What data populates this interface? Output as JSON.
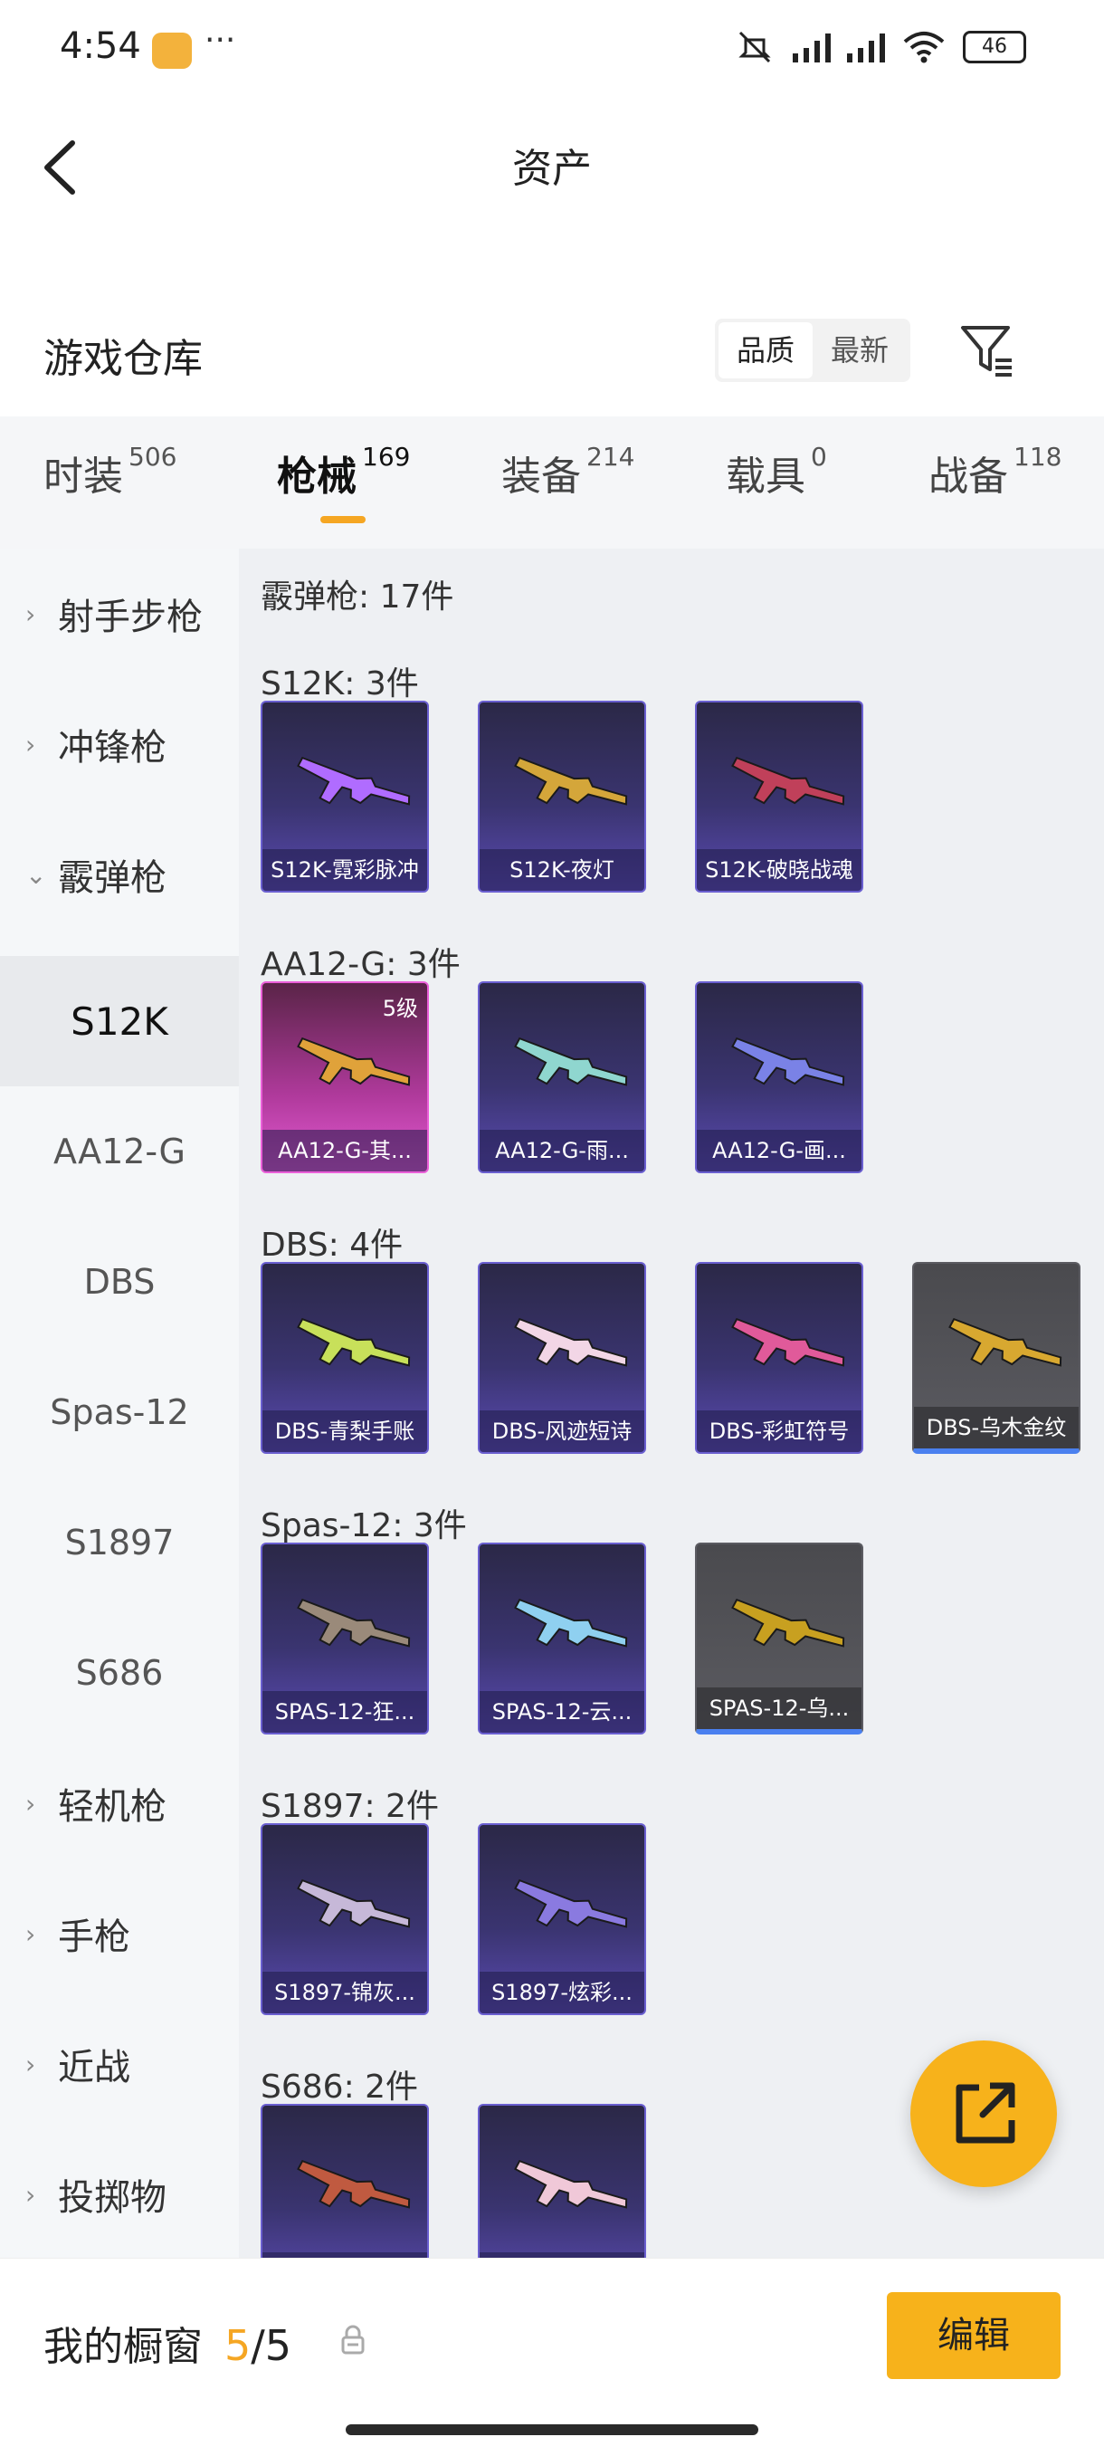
{
  "status_bar": {
    "time": "4:54",
    "dots": "···",
    "battery": "46"
  },
  "header": {
    "title": "资产"
  },
  "warehouse": {
    "title": "游戏仓库",
    "sort_quality": "品质",
    "sort_newest": "最新"
  },
  "tabs": [
    {
      "label": "时装",
      "count": "506"
    },
    {
      "label": "枪械",
      "count": "169"
    },
    {
      "label": "装备",
      "count": "214"
    },
    {
      "label": "载具",
      "count": "0"
    },
    {
      "label": "战备",
      "count": "118"
    }
  ],
  "sidebar": [
    {
      "label": "射手步枪",
      "chevron": "›"
    },
    {
      "label": "冲锋枪",
      "chevron": "›"
    },
    {
      "label": "霰弹枪",
      "chevron": "⌄"
    },
    {
      "label": "S12K"
    },
    {
      "label": "AA12-G"
    },
    {
      "label": "DBS"
    },
    {
      "label": "Spas-12"
    },
    {
      "label": "S1897"
    },
    {
      "label": "S686"
    },
    {
      "label": "轻机枪",
      "chevron": "›"
    },
    {
      "label": "手枪",
      "chevron": "›"
    },
    {
      "label": "近战",
      "chevron": "›"
    },
    {
      "label": "投掷物",
      "chevron": "›"
    }
  ],
  "content": {
    "category_header": "霰弹枪: 17件",
    "groups": [
      {
        "header": "S12K: 3件",
        "items": [
          {
            "name": "S12K-霓彩脉冲",
            "style": "purple",
            "gun_color": "#b06cff"
          },
          {
            "name": "S12K-夜灯",
            "style": "purple",
            "gun_color": "#d4a63a"
          },
          {
            "name": "S12K-破晓战魂",
            "style": "purple",
            "gun_color": "#c0405a"
          }
        ]
      },
      {
        "header": "AA12-G: 3件",
        "items": [
          {
            "name": "AA12-G-其...",
            "style": "gold",
            "level": "5级",
            "gun_color": "#e0a23a"
          },
          {
            "name": "AA12-G-雨...",
            "style": "purple",
            "gun_color": "#8fd6cf"
          },
          {
            "name": "AA12-G-画...",
            "style": "purple",
            "gun_color": "#7a82e6"
          }
        ]
      },
      {
        "header": "DBS: 4件",
        "items": [
          {
            "name": "DBS-青梨手账",
            "style": "purple",
            "gun_color": "#c8e05a"
          },
          {
            "name": "DBS-风迹短诗",
            "style": "purple",
            "gun_color": "#f2d6e6"
          },
          {
            "name": "DBS-彩虹符号",
            "style": "purple",
            "gun_color": "#e05a9a"
          },
          {
            "name": "DBS-乌木金纹",
            "style": "grey",
            "gun_color": "#d8a830"
          }
        ]
      },
      {
        "header": "Spas-12: 3件",
        "items": [
          {
            "name": "SPAS-12-狂...",
            "style": "purple",
            "gun_color": "#9a8a7a"
          },
          {
            "name": "SPAS-12-云...",
            "style": "purple",
            "gun_color": "#8fd0f0"
          },
          {
            "name": "SPAS-12-乌...",
            "style": "grey",
            "gun_color": "#c8a020"
          }
        ]
      },
      {
        "header": "S1897: 2件",
        "items": [
          {
            "name": "S1897-锦灰...",
            "style": "purple",
            "gun_color": "#c6b8d8"
          },
          {
            "name": "S1897-炫彩...",
            "style": "purple",
            "gun_color": "#8a7ae0"
          }
        ]
      },
      {
        "header": "S686: 2件",
        "items": [
          {
            "name": "",
            "style": "purple",
            "gun_color": "#c05a40"
          },
          {
            "name": "",
            "style": "purple",
            "gun_color": "#f0c8d8"
          }
        ]
      }
    ]
  },
  "bottom_bar": {
    "label": "我的橱窗",
    "count_current": "5",
    "count_sep": "/",
    "count_total": "5",
    "edit_label": "编辑"
  },
  "colors": {
    "accent": "#f7b21b",
    "indicator": "#f5a623"
  }
}
